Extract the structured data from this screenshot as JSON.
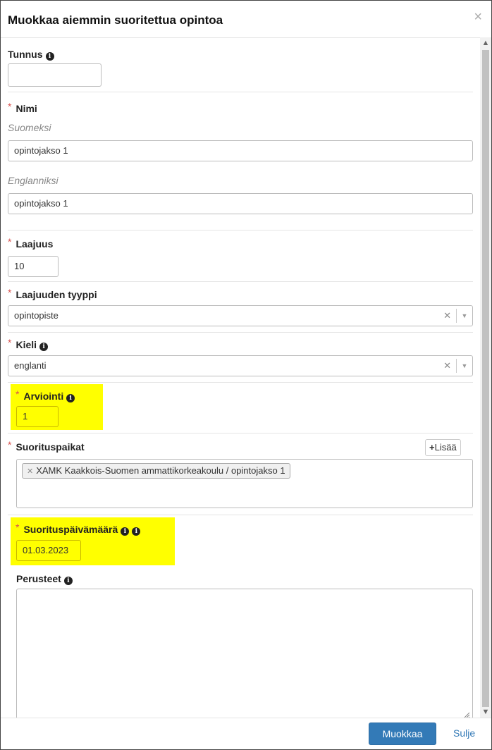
{
  "dialog": {
    "title": "Muokkaa aiemmin suoritettua opintoa",
    "close_symbol": "×"
  },
  "fields": {
    "tunnus": {
      "label": "Tunnus",
      "value": ""
    },
    "nimi": {
      "label": "Nimi",
      "fi_label": "Suomeksi",
      "fi_value": "opintojakso 1",
      "en_label": "Englanniksi",
      "en_value": "opintojakso 1"
    },
    "laajuus": {
      "label": "Laajuus",
      "value": "10"
    },
    "laajuuden_tyyppi": {
      "label": "Laajuuden tyyppi",
      "value": "opintopiste"
    },
    "kieli": {
      "label": "Kieli",
      "value": "englanti"
    },
    "arviointi": {
      "label": "Arviointi",
      "value": "1"
    },
    "suorituspaikat": {
      "label": "Suorituspaikat",
      "add_label": "Lisää",
      "tags": [
        "XAMK Kaakkois-Suomen ammattikorkeakoulu / opintojakso 1"
      ]
    },
    "suorituspaivamaara": {
      "label": "Suorituspäivämäärä",
      "value": "01.03.2023"
    },
    "perusteet": {
      "label": "Perusteet",
      "value": ""
    }
  },
  "footer": {
    "primary_label": "Muokkaa",
    "cancel_label": "Sulje"
  },
  "colors": {
    "required": "#d9534f",
    "highlight": "#ffff00",
    "primary": "#337ab7"
  },
  "icons": [
    "info-icon",
    "close-icon",
    "clear-icon",
    "dropdown-arrow-icon",
    "plus-icon",
    "resize-grip-icon"
  ]
}
